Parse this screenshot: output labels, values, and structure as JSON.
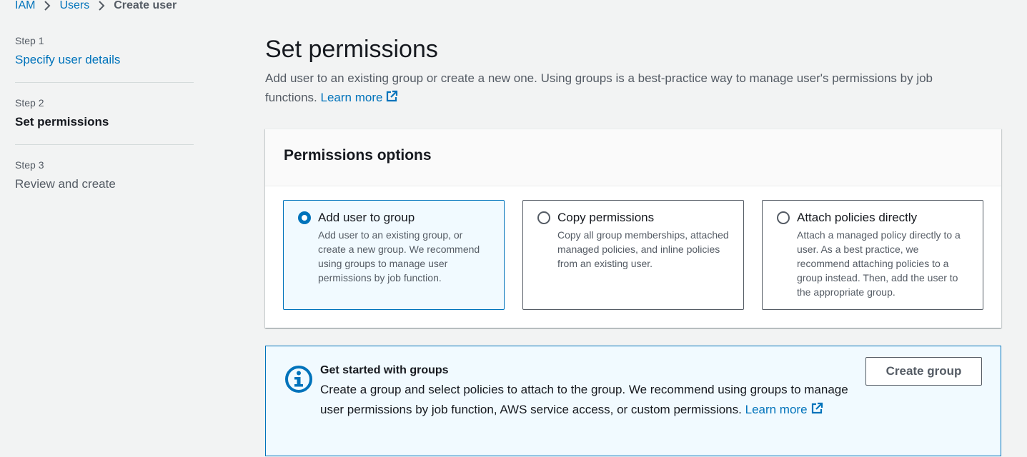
{
  "breadcrumb": {
    "items": [
      "IAM",
      "Users"
    ],
    "current": "Create user"
  },
  "steps": [
    {
      "num": "Step 1",
      "title": "Specify user details",
      "state": "link"
    },
    {
      "num": "Step 2",
      "title": "Set permissions",
      "state": "active"
    },
    {
      "num": "Step 3",
      "title": "Review and create",
      "state": "disabled"
    }
  ],
  "main": {
    "title": "Set permissions",
    "description": "Add user to an existing group or create a new one. Using groups is a best-practice way to manage user's permissions by job functions.",
    "learn_more": "Learn more"
  },
  "panel": {
    "title": "Permissions options",
    "options": [
      {
        "title": "Add user to group",
        "description": "Add user to an existing group, or create a new group. We recommend using groups to manage user permissions by job function.",
        "selected": true
      },
      {
        "title": "Copy permissions",
        "description": "Copy all group memberships, attached managed policies, and inline policies from an existing user.",
        "selected": false
      },
      {
        "title": "Attach policies directly",
        "description": "Attach a managed policy directly to a user. As a best practice, we recommend attaching policies to a group instead. Then, add the user to the appropriate group.",
        "selected": false
      }
    ]
  },
  "info": {
    "icon": "info-icon",
    "title": "Get started with groups",
    "text": "Create a group and select policies to attach to the group. We recommend using groups to manage user permissions by job function, AWS service access, or custom permissions.",
    "learn_more": "Learn more",
    "button_label": "Create group"
  },
  "colors": {
    "link": "#0073bb",
    "text": "#16191f",
    "muted": "#545b64",
    "background": "#f2f3f3",
    "selected_bg": "#f1faff"
  }
}
